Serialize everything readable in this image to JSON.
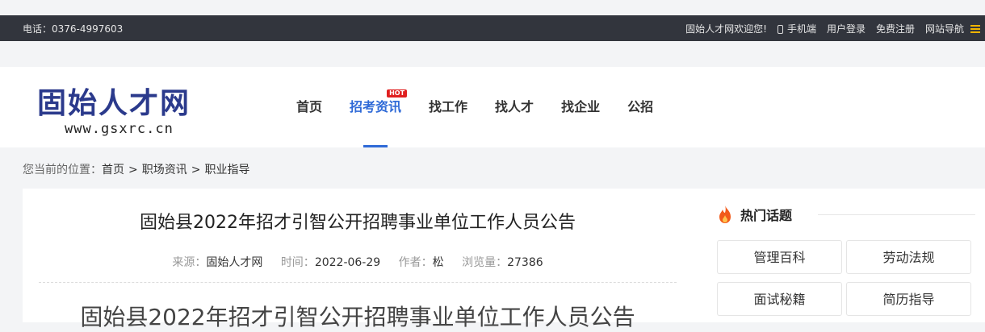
{
  "topbar": {
    "phone": "电话：0376-4997603",
    "welcome": "固始人才网欢迎您!",
    "mobile": "手机端",
    "login": "用户登录",
    "register": "免费注册",
    "site_nav": "网站导航"
  },
  "logo": {
    "name": "固始人才网",
    "url": "www.gsxrc.cn"
  },
  "nav": {
    "items": [
      {
        "label": "首页"
      },
      {
        "label": "招考资讯",
        "badge": "HOT"
      },
      {
        "label": "找工作"
      },
      {
        "label": "找人才"
      },
      {
        "label": "找企业"
      },
      {
        "label": "公招"
      }
    ]
  },
  "breadcrumb": {
    "prefix": "您当前的位置：",
    "items": [
      "首页",
      "职场资讯",
      "职业指导"
    ],
    "sep": ">"
  },
  "article": {
    "title": "固始县2022年招才引智公开招聘事业单位工作人员公告",
    "meta": {
      "source_label": "来源：",
      "source": "固始人才网",
      "time_label": "时间：",
      "time": "2022-06-29",
      "author_label": "作者：",
      "author": "松",
      "views_label": "浏览量：",
      "views": "27386"
    },
    "body_title": "固始县2022年招才引智公开招聘事业单位工作人员公告"
  },
  "sidebar": {
    "title": "热门话题",
    "tags": [
      "管理百科",
      "劳动法规",
      "面试秘籍",
      "简历指导"
    ]
  },
  "colors": {
    "accent": "#2f6ad7",
    "topbar": "#32353d",
    "hot": "#e02020",
    "logo": "#2b3a8c"
  }
}
